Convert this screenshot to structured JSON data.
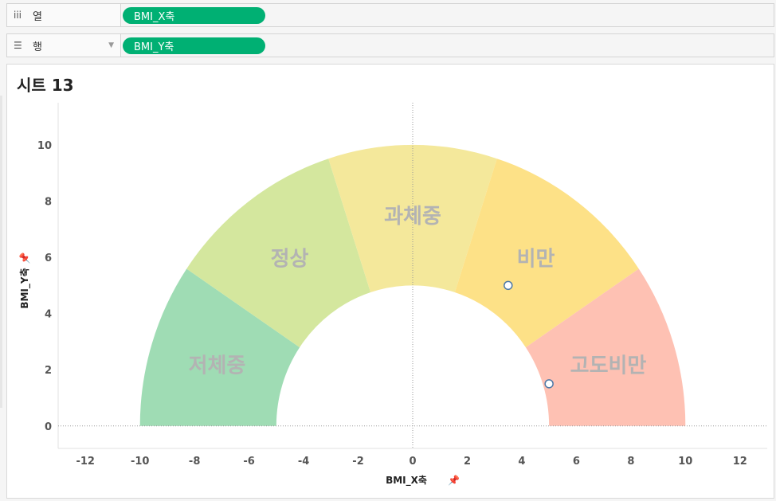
{
  "columns_shelf": {
    "label": "열",
    "icon": "columns-icon",
    "pill": "BMI_X축"
  },
  "rows_shelf": {
    "label": "행",
    "icon": "rows-icon",
    "pill": "BMI_Y축"
  },
  "sheet": {
    "title": "시트 13"
  },
  "chart_data": {
    "type": "scatter",
    "title": "",
    "xlabel": "BMI_X축",
    "ylabel": "BMI_Y축",
    "xlim": [
      -13,
      13
    ],
    "ylim": [
      -0.8,
      11.5
    ],
    "x_ticks": [
      -12,
      -10,
      -8,
      -6,
      -4,
      -2,
      0,
      2,
      4,
      6,
      8,
      10,
      12
    ],
    "y_ticks": [
      0,
      2,
      4,
      6,
      8,
      10
    ],
    "grid": false,
    "zero_lines": true,
    "gauge": {
      "inner_radius": 5,
      "outer_radius": 10,
      "segments": [
        {
          "label": "저체중",
          "start_deg": 180,
          "end_deg": 146,
          "color": "#9fdcb4"
        },
        {
          "label": "정상",
          "start_deg": 146,
          "end_deg": 108,
          "color": "#d4e79e"
        },
        {
          "label": "과체중",
          "start_deg": 108,
          "end_deg": 72,
          "color": "#f4e89b"
        },
        {
          "label": "비만",
          "start_deg": 72,
          "end_deg": 34,
          "color": "#fde187"
        },
        {
          "label": "고도비만",
          "start_deg": 34,
          "end_deg": 0,
          "color": "#fec1b3"
        }
      ]
    },
    "points": [
      {
        "x": 3.5,
        "y": 5.0
      },
      {
        "x": 5.0,
        "y": 1.5
      }
    ]
  }
}
